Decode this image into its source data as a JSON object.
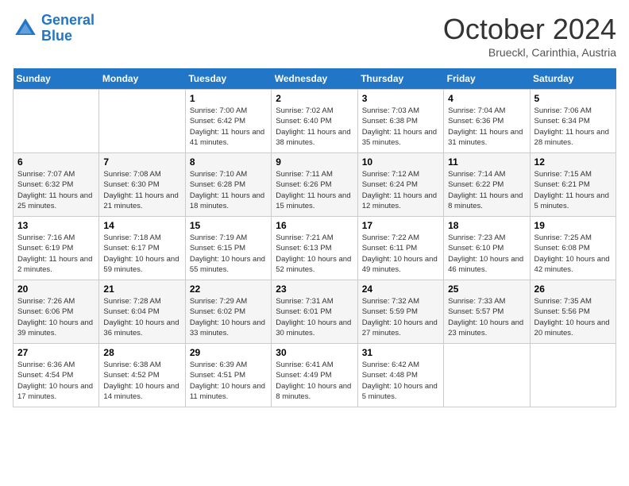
{
  "header": {
    "logo_line1": "General",
    "logo_line2": "Blue",
    "month": "October 2024",
    "location": "Brueckl, Carinthia, Austria"
  },
  "days_of_week": [
    "Sunday",
    "Monday",
    "Tuesday",
    "Wednesday",
    "Thursday",
    "Friday",
    "Saturday"
  ],
  "weeks": [
    [
      {
        "day": "",
        "info": ""
      },
      {
        "day": "",
        "info": ""
      },
      {
        "day": "1",
        "info": "Sunrise: 7:00 AM\nSunset: 6:42 PM\nDaylight: 11 hours and 41 minutes."
      },
      {
        "day": "2",
        "info": "Sunrise: 7:02 AM\nSunset: 6:40 PM\nDaylight: 11 hours and 38 minutes."
      },
      {
        "day": "3",
        "info": "Sunrise: 7:03 AM\nSunset: 6:38 PM\nDaylight: 11 hours and 35 minutes."
      },
      {
        "day": "4",
        "info": "Sunrise: 7:04 AM\nSunset: 6:36 PM\nDaylight: 11 hours and 31 minutes."
      },
      {
        "day": "5",
        "info": "Sunrise: 7:06 AM\nSunset: 6:34 PM\nDaylight: 11 hours and 28 minutes."
      }
    ],
    [
      {
        "day": "6",
        "info": "Sunrise: 7:07 AM\nSunset: 6:32 PM\nDaylight: 11 hours and 25 minutes."
      },
      {
        "day": "7",
        "info": "Sunrise: 7:08 AM\nSunset: 6:30 PM\nDaylight: 11 hours and 21 minutes."
      },
      {
        "day": "8",
        "info": "Sunrise: 7:10 AM\nSunset: 6:28 PM\nDaylight: 11 hours and 18 minutes."
      },
      {
        "day": "9",
        "info": "Sunrise: 7:11 AM\nSunset: 6:26 PM\nDaylight: 11 hours and 15 minutes."
      },
      {
        "day": "10",
        "info": "Sunrise: 7:12 AM\nSunset: 6:24 PM\nDaylight: 11 hours and 12 minutes."
      },
      {
        "day": "11",
        "info": "Sunrise: 7:14 AM\nSunset: 6:22 PM\nDaylight: 11 hours and 8 minutes."
      },
      {
        "day": "12",
        "info": "Sunrise: 7:15 AM\nSunset: 6:21 PM\nDaylight: 11 hours and 5 minutes."
      }
    ],
    [
      {
        "day": "13",
        "info": "Sunrise: 7:16 AM\nSunset: 6:19 PM\nDaylight: 11 hours and 2 minutes."
      },
      {
        "day": "14",
        "info": "Sunrise: 7:18 AM\nSunset: 6:17 PM\nDaylight: 10 hours and 59 minutes."
      },
      {
        "day": "15",
        "info": "Sunrise: 7:19 AM\nSunset: 6:15 PM\nDaylight: 10 hours and 55 minutes."
      },
      {
        "day": "16",
        "info": "Sunrise: 7:21 AM\nSunset: 6:13 PM\nDaylight: 10 hours and 52 minutes."
      },
      {
        "day": "17",
        "info": "Sunrise: 7:22 AM\nSunset: 6:11 PM\nDaylight: 10 hours and 49 minutes."
      },
      {
        "day": "18",
        "info": "Sunrise: 7:23 AM\nSunset: 6:10 PM\nDaylight: 10 hours and 46 minutes."
      },
      {
        "day": "19",
        "info": "Sunrise: 7:25 AM\nSunset: 6:08 PM\nDaylight: 10 hours and 42 minutes."
      }
    ],
    [
      {
        "day": "20",
        "info": "Sunrise: 7:26 AM\nSunset: 6:06 PM\nDaylight: 10 hours and 39 minutes."
      },
      {
        "day": "21",
        "info": "Sunrise: 7:28 AM\nSunset: 6:04 PM\nDaylight: 10 hours and 36 minutes."
      },
      {
        "day": "22",
        "info": "Sunrise: 7:29 AM\nSunset: 6:02 PM\nDaylight: 10 hours and 33 minutes."
      },
      {
        "day": "23",
        "info": "Sunrise: 7:31 AM\nSunset: 6:01 PM\nDaylight: 10 hours and 30 minutes."
      },
      {
        "day": "24",
        "info": "Sunrise: 7:32 AM\nSunset: 5:59 PM\nDaylight: 10 hours and 27 minutes."
      },
      {
        "day": "25",
        "info": "Sunrise: 7:33 AM\nSunset: 5:57 PM\nDaylight: 10 hours and 23 minutes."
      },
      {
        "day": "26",
        "info": "Sunrise: 7:35 AM\nSunset: 5:56 PM\nDaylight: 10 hours and 20 minutes."
      }
    ],
    [
      {
        "day": "27",
        "info": "Sunrise: 6:36 AM\nSunset: 4:54 PM\nDaylight: 10 hours and 17 minutes."
      },
      {
        "day": "28",
        "info": "Sunrise: 6:38 AM\nSunset: 4:52 PM\nDaylight: 10 hours and 14 minutes."
      },
      {
        "day": "29",
        "info": "Sunrise: 6:39 AM\nSunset: 4:51 PM\nDaylight: 10 hours and 11 minutes."
      },
      {
        "day": "30",
        "info": "Sunrise: 6:41 AM\nSunset: 4:49 PM\nDaylight: 10 hours and 8 minutes."
      },
      {
        "day": "31",
        "info": "Sunrise: 6:42 AM\nSunset: 4:48 PM\nDaylight: 10 hours and 5 minutes."
      },
      {
        "day": "",
        "info": ""
      },
      {
        "day": "",
        "info": ""
      }
    ]
  ]
}
